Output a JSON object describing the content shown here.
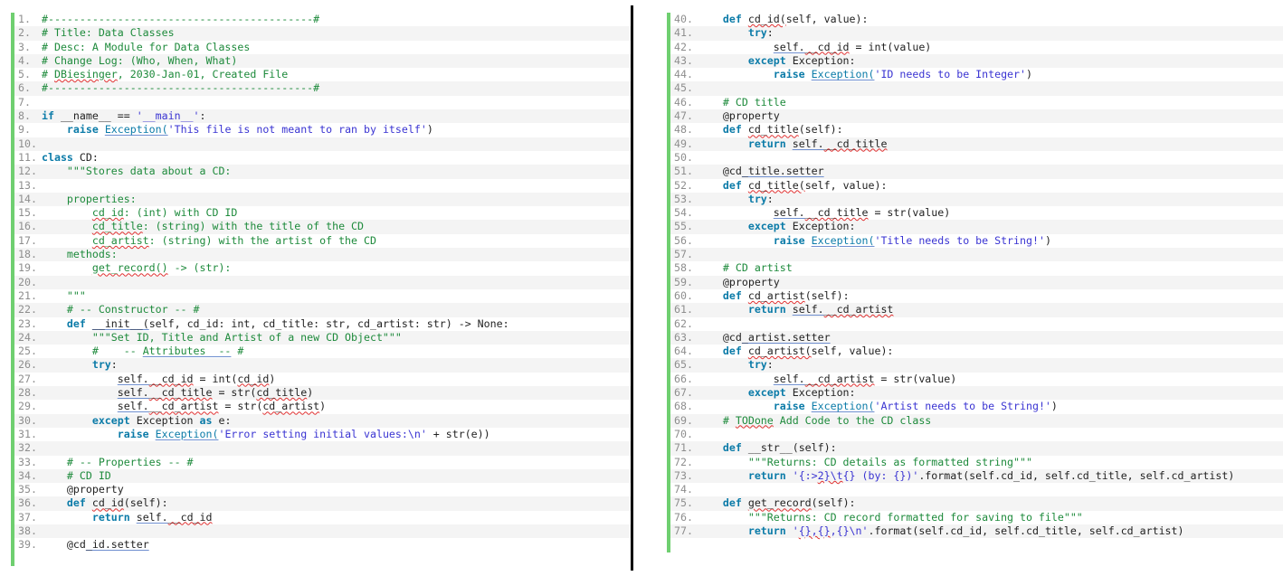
{
  "editor": {
    "language": "python",
    "colors": {
      "background": "#ffffff",
      "alt_row": "#f4f4f4",
      "gutter_text": "#8e8e8e",
      "change_bar": "#6fcf70",
      "keyword": "#0b7ba8",
      "comment": "#1d8a3b",
      "string": "#3a34d2",
      "text": "#222222",
      "squiggle": "#e03030",
      "divider": "#000000"
    }
  },
  "left_column": {
    "first_line": 1,
    "last_line": 39,
    "lines": [
      {
        "n": "1.",
        "text": "#------------------------------------------#"
      },
      {
        "n": "2.",
        "text": "# Title: Data Classes"
      },
      {
        "n": "3.",
        "text": "# Desc: A Module for Data Classes"
      },
      {
        "n": "4.",
        "text": "# Change Log: (Who, When, What)"
      },
      {
        "n": "5.",
        "text": "# DBiesinger, 2030-Jan-01, Created File"
      },
      {
        "n": "6.",
        "text": "#------------------------------------------#"
      },
      {
        "n": "7.",
        "text": ""
      },
      {
        "n": "8.",
        "text": "if __name__ == '__main__':"
      },
      {
        "n": "9.",
        "text": "    raise Exception('This file is not meant to ran by itself')"
      },
      {
        "n": "10.",
        "text": ""
      },
      {
        "n": "11.",
        "text": "class CD:"
      },
      {
        "n": "12.",
        "text": "    \"\"\"Stores data about a CD:"
      },
      {
        "n": "13.",
        "text": ""
      },
      {
        "n": "14.",
        "text": "    properties:"
      },
      {
        "n": "15.",
        "text": "        cd_id: (int) with CD ID"
      },
      {
        "n": "16.",
        "text": "        cd_title: (string) with the title of the CD"
      },
      {
        "n": "17.",
        "text": "        cd_artist: (string) with the artist of the CD"
      },
      {
        "n": "18.",
        "text": "    methods:"
      },
      {
        "n": "19.",
        "text": "        get_record() -> (str):"
      },
      {
        "n": "20.",
        "text": ""
      },
      {
        "n": "21.",
        "text": "    \"\"\""
      },
      {
        "n": "22.",
        "text": "    # -- Constructor -- #"
      },
      {
        "n": "23.",
        "text": "    def __init__(self, cd_id: int, cd_title: str, cd_artist: str) -> None:"
      },
      {
        "n": "24.",
        "text": "        \"\"\"Set ID, Title and Artist of a new CD Object\"\"\""
      },
      {
        "n": "25.",
        "text": "        #    -- Attributes  -- #"
      },
      {
        "n": "26.",
        "text": "        try:"
      },
      {
        "n": "27.",
        "text": "            self.__cd_id = int(cd_id)"
      },
      {
        "n": "28.",
        "text": "            self.__cd_title = str(cd_title)"
      },
      {
        "n": "29.",
        "text": "            self.__cd_artist = str(cd_artist)"
      },
      {
        "n": "30.",
        "text": "        except Exception as e:"
      },
      {
        "n": "31.",
        "text": "            raise Exception('Error setting initial values:\\n' + str(e))"
      },
      {
        "n": "32.",
        "text": ""
      },
      {
        "n": "33.",
        "text": "    # -- Properties -- #"
      },
      {
        "n": "34.",
        "text": "    # CD ID"
      },
      {
        "n": "35.",
        "text": "    @property"
      },
      {
        "n": "36.",
        "text": "    def cd_id(self):"
      },
      {
        "n": "37.",
        "text": "        return self.__cd_id"
      },
      {
        "n": "38.",
        "text": ""
      },
      {
        "n": "39.",
        "text": "    @cd_id.setter"
      }
    ]
  },
  "right_column": {
    "first_line": 40,
    "last_line": 77,
    "lines": [
      {
        "n": "40.",
        "text": "    def cd_id(self, value):"
      },
      {
        "n": "41.",
        "text": "        try:"
      },
      {
        "n": "42.",
        "text": "            self.__cd_id = int(value)"
      },
      {
        "n": "43.",
        "text": "        except Exception:"
      },
      {
        "n": "44.",
        "text": "            raise Exception('ID needs to be Integer')"
      },
      {
        "n": "45.",
        "text": ""
      },
      {
        "n": "46.",
        "text": "    # CD title"
      },
      {
        "n": "47.",
        "text": "    @property"
      },
      {
        "n": "48.",
        "text": "    def cd_title(self):"
      },
      {
        "n": "49.",
        "text": "        return self.__cd_title"
      },
      {
        "n": "50.",
        "text": ""
      },
      {
        "n": "51.",
        "text": "    @cd_title.setter"
      },
      {
        "n": "52.",
        "text": "    def cd_title(self, value):"
      },
      {
        "n": "53.",
        "text": "        try:"
      },
      {
        "n": "54.",
        "text": "            self.__cd_title = str(value)"
      },
      {
        "n": "55.",
        "text": "        except Exception:"
      },
      {
        "n": "56.",
        "text": "            raise Exception('Title needs to be String!')"
      },
      {
        "n": "57.",
        "text": ""
      },
      {
        "n": "58.",
        "text": "    # CD artist"
      },
      {
        "n": "59.",
        "text": "    @property"
      },
      {
        "n": "60.",
        "text": "    def cd_artist(self):"
      },
      {
        "n": "61.",
        "text": "        return self.__cd_artist"
      },
      {
        "n": "62.",
        "text": ""
      },
      {
        "n": "63.",
        "text": "    @cd_artist.setter"
      },
      {
        "n": "64.",
        "text": "    def cd_artist(self, value):"
      },
      {
        "n": "65.",
        "text": "        try:"
      },
      {
        "n": "66.",
        "text": "            self.__cd_artist = str(value)"
      },
      {
        "n": "67.",
        "text": "        except Exception:"
      },
      {
        "n": "68.",
        "text": "            raise Exception('Artist needs to be String!')"
      },
      {
        "n": "69.",
        "text": "    # TODone Add Code to the CD class"
      },
      {
        "n": "70.",
        "text": ""
      },
      {
        "n": "71.",
        "text": "    def __str__(self):"
      },
      {
        "n": "72.",
        "text": "        \"\"\"Returns: CD details as formatted string\"\"\""
      },
      {
        "n": "73.",
        "text": "        return '{:>2}\\t{} (by: {})'.format(self.cd_id, self.cd_title, self.cd_artist)"
      },
      {
        "n": "74.",
        "text": ""
      },
      {
        "n": "75.",
        "text": "    def get_record(self):"
      },
      {
        "n": "76.",
        "text": "        \"\"\"Returns: CD record formatted for saving to file\"\"\""
      },
      {
        "n": "77.",
        "text": "        return '{},{},{}\\n'.format(self.cd_id, self.cd_title, self.cd_artist)"
      }
    ]
  }
}
